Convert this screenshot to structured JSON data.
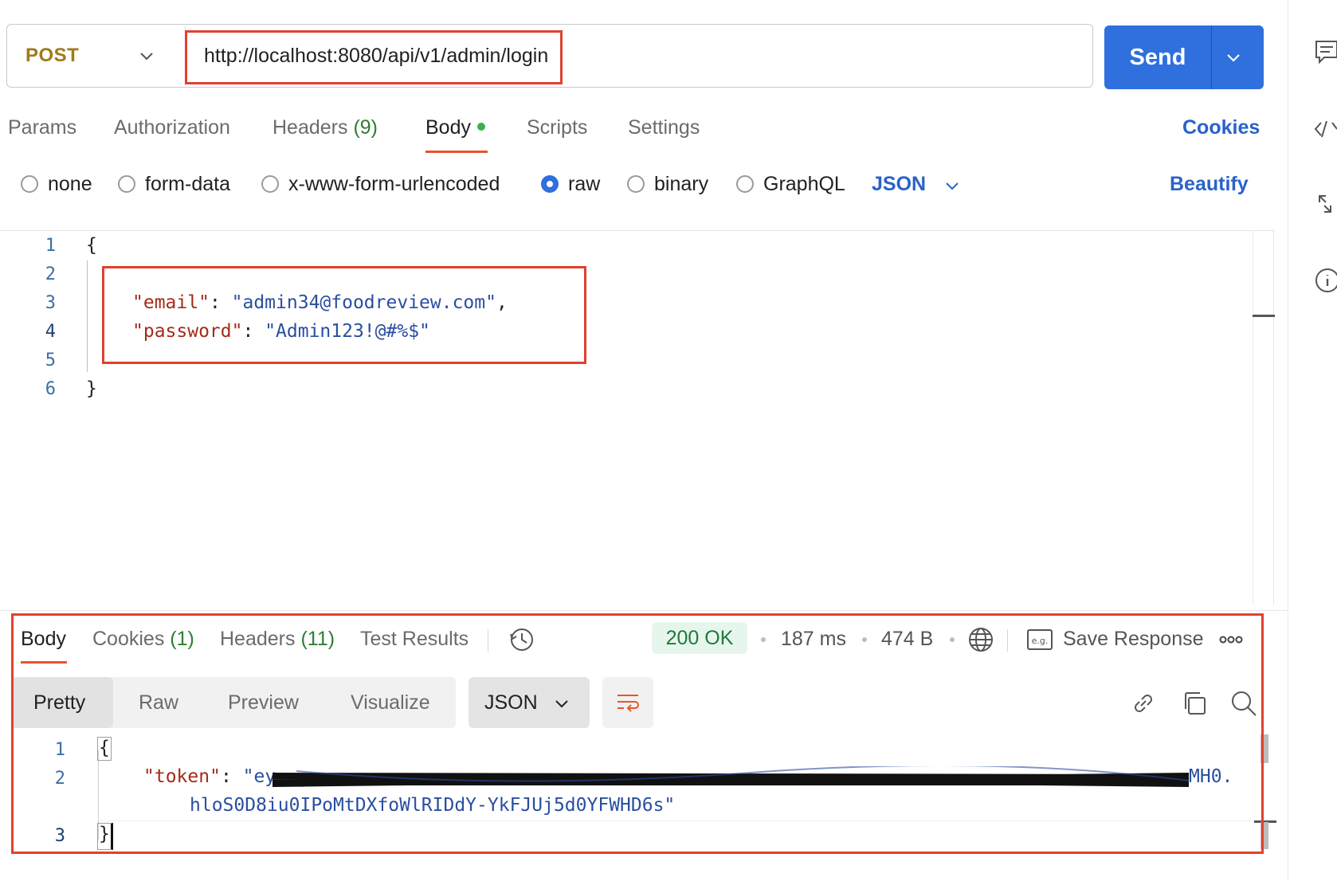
{
  "request": {
    "method": "POST",
    "url": "http://localhost:8080/api/v1/admin/login",
    "send_label": "Send"
  },
  "request_tabs": {
    "params": "Params",
    "authorization": "Authorization",
    "headers": "Headers",
    "headers_count": "(9)",
    "body": "Body",
    "scripts": "Scripts",
    "settings": "Settings",
    "cookies": "Cookies"
  },
  "body_types": {
    "none": "none",
    "form_data": "form-data",
    "urlencoded": "x-www-form-urlencoded",
    "raw": "raw",
    "binary": "binary",
    "graphql": "GraphQL",
    "selected": "raw",
    "language": "JSON",
    "beautify": "Beautify"
  },
  "request_body": {
    "line_numbers": [
      "1",
      "2",
      "3",
      "4",
      "5",
      "6"
    ],
    "open_brace": "{",
    "close_brace": "}",
    "email_key": "\"email\"",
    "email_value": "\"admin34@foodreview.com\"",
    "password_key": "\"password\"",
    "password_value": "\"Admin123!@#%$\""
  },
  "response_tabs": {
    "body": "Body",
    "cookies": "Cookies",
    "cookies_count": "(1)",
    "headers": "Headers",
    "headers_count": "(11)",
    "test_results": "Test Results"
  },
  "response_meta": {
    "status": "200 OK",
    "time": "187 ms",
    "size": "474 B",
    "save_response": "Save Response",
    "status_color": "#1f7a3a"
  },
  "response_view": {
    "pretty": "Pretty",
    "raw": "Raw",
    "preview": "Preview",
    "visualize": "Visualize",
    "format": "JSON"
  },
  "response_body": {
    "line_numbers": [
      "1",
      "2",
      "3"
    ],
    "open_brace": "{",
    "close_brace": "}",
    "token_key": "\"token\"",
    "token_start": "\"ey",
    "token_end": "MH0.",
    "token_line2": "hloS0D8iu0IPoMtDXfoWlRIDdY-YkFJUj5d0YFWHD6s\""
  },
  "icons": {
    "history": "history-icon",
    "globe": "globe-icon",
    "example": "example-icon",
    "more": "more-icon",
    "link": "link-icon",
    "copy": "copy-icon",
    "search": "search-icon",
    "wrap": "wrap-lines-icon",
    "rail": [
      "comments-icon",
      "code-icon",
      "expand-icon",
      "info-icon"
    ]
  },
  "colors": {
    "accent": "#2f6fde",
    "tab_indicator": "#e8542c",
    "annotation_red": "#e0412e"
  }
}
